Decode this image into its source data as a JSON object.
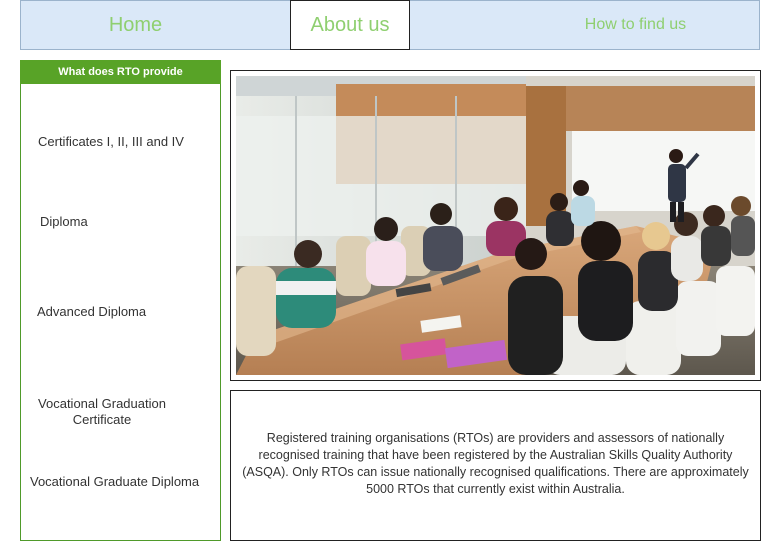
{
  "nav": {
    "home_label": "Home",
    "about_label": "About us",
    "find_label": "How to find us"
  },
  "sidebar": {
    "header": "What does RTO provide",
    "items": [
      {
        "label": "Certificates I, II, III and IV"
      },
      {
        "label": "Diploma"
      },
      {
        "label": "Advanced Diploma"
      },
      {
        "label": "Vocational Graduation Certificate"
      },
      {
        "label": "Vocational Graduate Diploma"
      }
    ]
  },
  "main": {
    "photo_alt": "Meeting room with people seated around a table watching a presenter at a whiteboard",
    "description": "Registered training organisations (RTOs) are providers and assessors of nationally recognised training that have been registered by the Australian Skills Quality Authority (ASQA). Only RTOs can issue nationally recognised qualifications. There are approximately 5000 RTOs that currently exist within Australia."
  },
  "colors": {
    "nav_bg": "#dae8f8",
    "nav_text": "#8fcf70",
    "sidebar_header_bg": "#58a327",
    "sidebar_border": "#4f9a2a"
  }
}
